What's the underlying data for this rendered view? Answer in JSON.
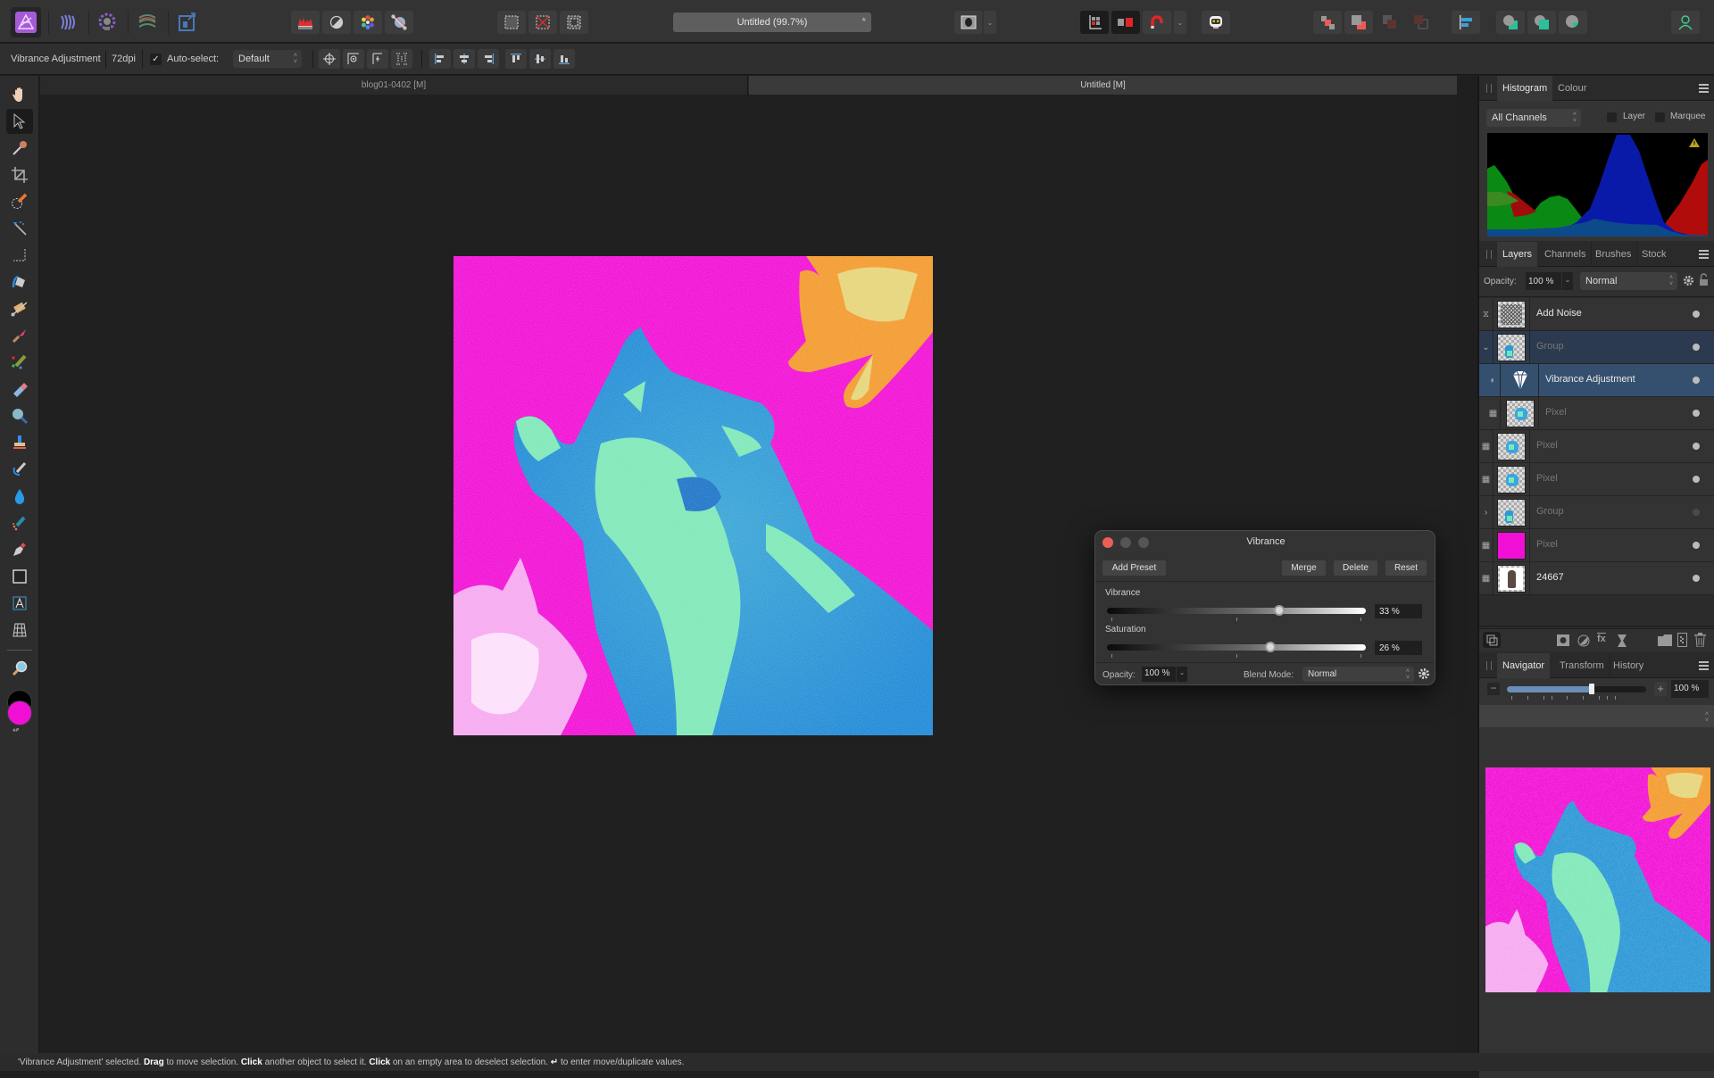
{
  "app": {
    "personas": [
      "photo-persona",
      "liquify-persona",
      "develop-persona",
      "tone-mapping-persona",
      "export-persona"
    ],
    "document_title": "Untitled (99.7%)",
    "document_modified_mark": "*"
  },
  "topbar": {
    "quick_buttons": [
      "levels-icon",
      "contrast-icon",
      "colour-wheel-icon",
      "white-balance-icon"
    ],
    "selection_buttons": [
      "select-all-icon",
      "deselect-icon",
      "invert-selection-icon"
    ],
    "quick_mask": "quick-mask-icon",
    "snapping": [
      "snapping-icon",
      "snapping-candidates-icon",
      "snapping-magnet-icon"
    ],
    "assistant": "assistant-icon",
    "arrange": [
      "move-forward-icon",
      "move-back-icon",
      "move-to-front-icon",
      "move-to-back-icon"
    ],
    "align": "align-icon",
    "boolean": [
      "add-icon",
      "subtract-icon",
      "intersect-icon"
    ],
    "account": "account-icon"
  },
  "context_toolbar": {
    "selection_label": "Vibrance Adjustment",
    "dpi": "72dpi",
    "auto_select_checked": true,
    "auto_select_label": "Auto-select:",
    "auto_select_value": "Default"
  },
  "doc_tabs": [
    {
      "label": "blog01-0402 [M]",
      "active": false
    },
    {
      "label": "Untitled [M]",
      "active": true
    }
  ],
  "tools": [
    "hand-tool",
    "move-tool",
    "colour-picker-tool",
    "crop-tool",
    "selection-brush-tool",
    "flood-select-tool",
    "marquee-tool",
    "flood-fill-tool",
    "gradient-tool",
    "paint-brush-tool",
    "paint-mixer-brush-tool",
    "erase-brush-tool",
    "dodge-brush-tool",
    "clone-brush-tool",
    "smudge-brush-tool",
    "blur-brush-tool",
    "healing-brush-tool",
    "pen-tool",
    "rectangle-tool",
    "artistic-text-tool",
    "mesh-warp-tool",
    "zoom-tool"
  ],
  "colors": {
    "primary": "#f20fd5",
    "secondary": "#000000",
    "accent_selected_layer": "#35506f"
  },
  "histogram_panel": {
    "tabs": [
      "Histogram",
      "Colour"
    ],
    "active_tab": "Histogram",
    "channel": "All Channels",
    "layer_label": "Layer",
    "layer_checked": false,
    "marquee_label": "Marquee",
    "marquee_checked": false,
    "warning": "warning-icon"
  },
  "layers_panel": {
    "tabs": [
      "Layers",
      "Channels",
      "Brushes",
      "Stock"
    ],
    "active_tab": "Layers",
    "opacity_label": "Opacity:",
    "opacity_value": "100 %",
    "blend_mode": "Normal",
    "layers": [
      {
        "name": "Add Noise",
        "type": "live-filter",
        "visible": true,
        "dim": false,
        "indent": 0,
        "state": "normal"
      },
      {
        "name": "Group",
        "type": "group",
        "visible": true,
        "dim": true,
        "indent": 0,
        "state": "grouped",
        "expanded": true
      },
      {
        "name": "Vibrance Adjustment",
        "type": "adjustment",
        "visible": true,
        "dim": false,
        "indent": 1,
        "state": "selected"
      },
      {
        "name": "Pixel",
        "type": "pixel",
        "visible": true,
        "dim": true,
        "indent": 1,
        "state": "normal"
      },
      {
        "name": "Pixel",
        "type": "pixel",
        "visible": true,
        "dim": true,
        "indent": 0,
        "state": "normal"
      },
      {
        "name": "Pixel",
        "type": "pixel",
        "visible": true,
        "dim": true,
        "indent": 0,
        "state": "normal"
      },
      {
        "name": "Group",
        "type": "group",
        "visible": false,
        "dim": true,
        "indent": 0,
        "state": "normal",
        "expanded": false
      },
      {
        "name": "Pixel",
        "type": "pixel-fill",
        "visible": true,
        "dim": true,
        "indent": 0,
        "state": "normal"
      },
      {
        "name": "24667",
        "type": "image",
        "visible": true,
        "dim": false,
        "indent": 0,
        "state": "normal"
      }
    ],
    "footer_icons": [
      "layer-options-icon",
      "mask-layer-icon",
      "adjustment-icon",
      "fx-icon",
      "live-filter-icon",
      "add-group-icon",
      "add-pixel-layer-icon",
      "delete-layer-icon"
    ]
  },
  "navigator_panel": {
    "tabs": [
      "Navigator",
      "Transform",
      "History"
    ],
    "active_tab": "Navigator",
    "zoom_value": "100 %",
    "zoom_slider_fraction": 0.61
  },
  "vibrance_dialog": {
    "title": "Vibrance",
    "add_preset": "Add Preset",
    "merge": "Merge",
    "delete": "Delete",
    "reset": "Reset",
    "sliders": [
      {
        "label": "Vibrance",
        "value": "33 %",
        "fraction": 0.665
      },
      {
        "label": "Saturation",
        "value": "26 %",
        "fraction": 0.63
      }
    ],
    "opacity_label": "Opacity:",
    "opacity_value": "100 %",
    "blend_mode_label": "Blend Mode:",
    "blend_mode_value": "Normal"
  },
  "status_bar": {
    "p1": "'Vibrance Adjustment' selected. ",
    "b1": "Drag",
    "p2": " to move selection. ",
    "b2": "Click",
    "p3": " another object to select it. ",
    "b3": "Click",
    "p4": " on an empty area to deselect selection. ",
    "p5": " to enter move/duplicate values."
  }
}
